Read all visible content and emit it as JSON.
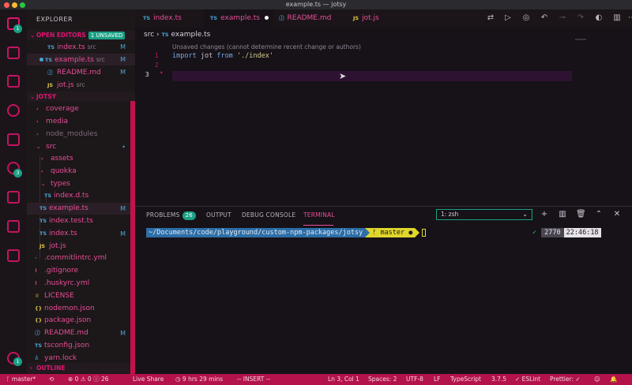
{
  "window": {
    "title": "example.ts — jotsy"
  },
  "activity_bar": {
    "items": [
      {
        "name": "explorer",
        "badge": "1"
      },
      {
        "name": "window"
      },
      {
        "name": "extensions"
      },
      {
        "name": "search"
      },
      {
        "name": "debug"
      },
      {
        "name": "source-control",
        "badge": "3"
      },
      {
        "name": "settings-sync"
      },
      {
        "name": "bookmark"
      },
      {
        "name": "pages"
      },
      {
        "name": "settings",
        "badge": "1"
      }
    ]
  },
  "sidebar": {
    "title": "EXPLORER",
    "open_editors": {
      "label": "OPEN EDITORS",
      "badge": "1 UNSAVED",
      "files": [
        {
          "icon": "TS",
          "name": "index.ts",
          "sub": "src",
          "mark": "M"
        },
        {
          "icon": "TS",
          "name": "example.ts",
          "sub": "src",
          "mark": "M"
        },
        {
          "icon": "ⓘ",
          "name": "README.md",
          "sub": "",
          "mark": "M"
        },
        {
          "icon": "JS",
          "name": "jot.js",
          "sub": "src",
          "mark": ""
        }
      ]
    },
    "project": {
      "label": "JOTSY",
      "tree": [
        {
          "chev": "›",
          "icon": "",
          "name": "coverage",
          "mark": ""
        },
        {
          "chev": "›",
          "icon": "",
          "name": "media",
          "mark": ""
        },
        {
          "chev": "›",
          "icon": "",
          "name": "node_modules",
          "mark": ""
        },
        {
          "chev": "⌄",
          "icon": "",
          "name": "src",
          "mark": "•"
        },
        {
          "chev": "›",
          "icon": "",
          "name": "assets",
          "mark": ""
        },
        {
          "chev": "›",
          "icon": "",
          "name": "quokka",
          "mark": ""
        },
        {
          "chev": "⌄",
          "icon": "",
          "name": "types",
          "mark": ""
        },
        {
          "chev": "",
          "icon": "TS",
          "name": "index.d.ts",
          "mark": ""
        },
        {
          "chev": "",
          "icon": "TS",
          "name": "example.ts",
          "mark": "M"
        },
        {
          "chev": "",
          "icon": "TS",
          "name": "index.test.ts",
          "mark": ""
        },
        {
          "chev": "",
          "icon": "TS",
          "name": "index.ts",
          "mark": "M"
        },
        {
          "chev": "",
          "icon": "JS",
          "name": "jot.js",
          "mark": ""
        },
        {
          "chev": "",
          "icon": "·",
          "name": ".commitlintrc.yml",
          "mark": ""
        },
        {
          "chev": "",
          "icon": "!",
          "name": ".gitignore",
          "mark": ""
        },
        {
          "chev": "",
          "icon": "!",
          "name": ".huskyrc.yml",
          "mark": ""
        },
        {
          "chev": "",
          "icon": "♕",
          "name": "LICENSE",
          "mark": ""
        },
        {
          "chev": "",
          "icon": "{}",
          "name": "nodemon.json",
          "mark": ""
        },
        {
          "chev": "",
          "icon": "{}",
          "name": "package.json",
          "mark": ""
        },
        {
          "chev": "",
          "icon": "ⓘ",
          "name": "README.md",
          "mark": "M"
        },
        {
          "chev": "",
          "icon": "TS",
          "name": "tsconfig.json",
          "mark": ""
        },
        {
          "chev": "",
          "icon": "♁",
          "name": "yarn.lock",
          "mark": ""
        }
      ]
    },
    "outline_label": "OUTLINE"
  },
  "tabs": [
    {
      "icon": "TS",
      "label": "index.ts"
    },
    {
      "icon": "TS",
      "label": "example.ts"
    },
    {
      "icon": "ⓘ",
      "label": "README.md"
    },
    {
      "icon": "JS",
      "label": "jot.js"
    }
  ],
  "editor": {
    "breadcrumb_folder": "src",
    "breadcrumb_sep": "›",
    "breadcrumb_icon": "TS",
    "breadcrumb_file": "example.ts",
    "codelens": "Unsaved changes (cannot determine recent change or authors)",
    "line_numbers": [
      "1",
      "2",
      "3"
    ],
    "code_kw1": "import",
    "code_ident": "jot",
    "code_kw2": "from",
    "code_str": "'./index'"
  },
  "panel": {
    "tabs": {
      "problems": "PROBLEMS",
      "problems_count": "26",
      "output": "OUTPUT",
      "debug_console": "DEBUG CONSOLE",
      "terminal": "TERMINAL"
    },
    "terminal_select": "1: zsh",
    "prompt_path": "~/Documents/code/playground/custom-npm-packages/jotsy",
    "prompt_git": "ᚠ master ●",
    "rprompt_check": "✓",
    "rprompt_num": "2770",
    "rprompt_time": "22:46:18"
  },
  "statusbar": {
    "branch": "ᚴ master*",
    "sync": "⟲",
    "problems": "⊗ 0 ⚠ 0 ⓘ 26",
    "live_share": "Live Share",
    "time": "◷ 9 hrs 29 mins",
    "mode": "-- INSERT --",
    "position": "Ln 3, Col 1",
    "spaces": "Spaces: 2",
    "encoding": "UTF-8",
    "eol": "LF",
    "language": "TypeScript",
    "version": "3.7.5",
    "eslint": "✓ ESLint",
    "prettier": "Prettier: ✓"
  },
  "colors": {
    "accent": "#e0146f",
    "status_bar": "#b3124b",
    "badge": "#1aa085",
    "current_line": "#2e1232"
  }
}
